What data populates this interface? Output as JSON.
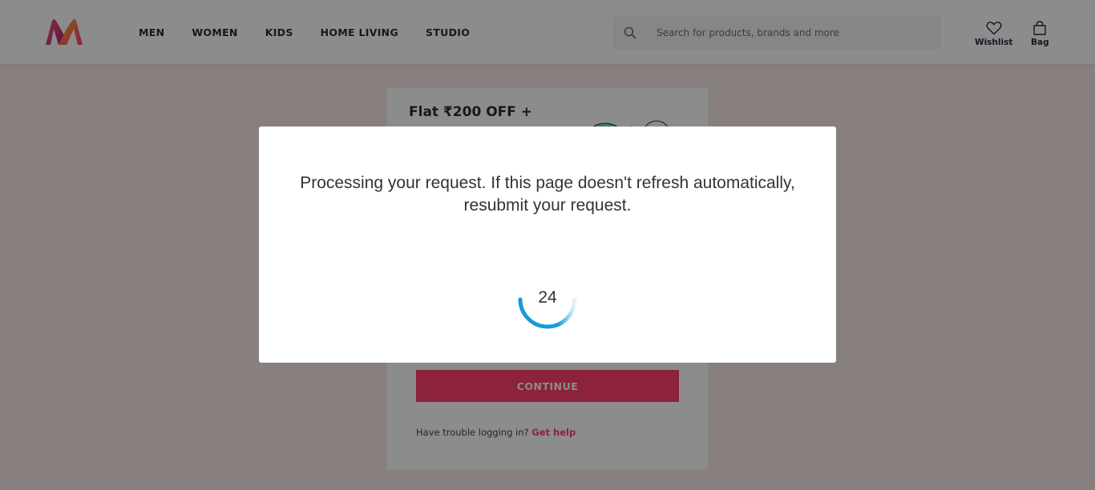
{
  "header": {
    "nav": [
      "MEN",
      "WOMEN",
      "KIDS",
      "HOME LIVING",
      "STUDIO"
    ],
    "search_placeholder": "Search for products, brands and more",
    "wishlist_label": "Wishlist",
    "bag_label": "Bag"
  },
  "login": {
    "promo_text": "Flat ₹200 OFF +",
    "continue_label": "CONTINUE",
    "trouble_text": "Have trouble logging in?",
    "help_link": "Get help"
  },
  "modal": {
    "message": "Processing your request. If this page doesn't refresh automatically, resubmit your request.",
    "countdown": "24",
    "progress_fraction": 0.5
  },
  "colors": {
    "brand_pink": "#ff3f6c",
    "spinner_blue": "#1a9bd7"
  },
  "icons": {
    "logo": "myntra-logo",
    "search": "search-icon",
    "wishlist": "heart-icon",
    "bag": "bag-icon"
  }
}
